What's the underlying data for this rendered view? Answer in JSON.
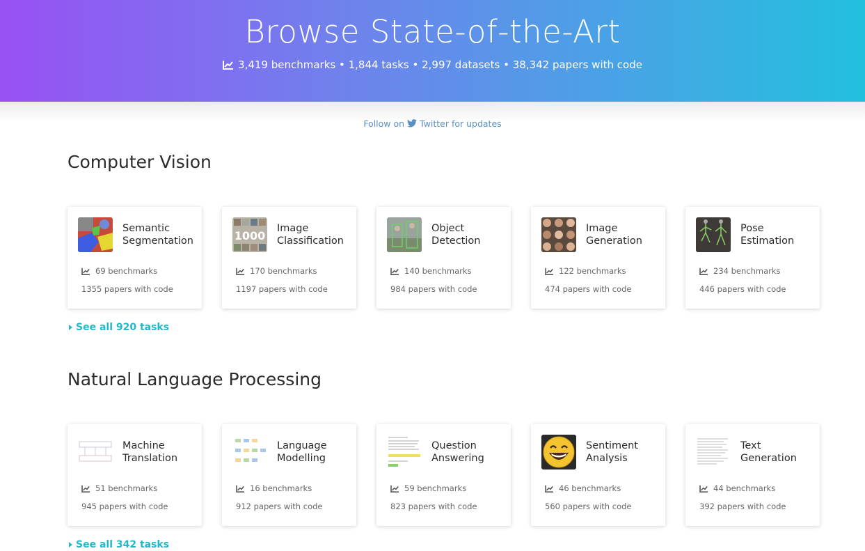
{
  "hero": {
    "title": "Browse State-of-the-Art",
    "stats": "3,419 benchmarks • 1,844 tasks • 2,997 datasets • 38,342 papers with code",
    "colors": {
      "gradient_start": "#9851f4",
      "gradient_end": "#22c0de"
    }
  },
  "follow": {
    "prefix": "Follow on",
    "suffix": "Twitter for updates"
  },
  "sections": [
    {
      "title": "Computer Vision",
      "see_all": "See all 920 tasks",
      "cards": [
        {
          "name": "Semantic Segmentation",
          "benchmarks": "69 benchmarks",
          "papers": "1355 papers with code"
        },
        {
          "name": "Image Classification",
          "benchmarks": "170 benchmarks",
          "papers": "1197 papers with code"
        },
        {
          "name": "Object Detection",
          "benchmarks": "140 benchmarks",
          "papers": "984 papers with code"
        },
        {
          "name": "Image Generation",
          "benchmarks": "122 benchmarks",
          "papers": "474 papers with code"
        },
        {
          "name": "Pose Estimation",
          "benchmarks": "234 benchmarks",
          "papers": "446 papers with code"
        }
      ]
    },
    {
      "title": "Natural Language Processing",
      "see_all": "See all 342 tasks",
      "cards": [
        {
          "name": "Machine Translation",
          "benchmarks": "51 benchmarks",
          "papers": "945 papers with code"
        },
        {
          "name": "Language Modelling",
          "benchmarks": "16 benchmarks",
          "papers": "912 papers with code"
        },
        {
          "name": "Question Answering",
          "benchmarks": "59 benchmarks",
          "papers": "823 papers with code"
        },
        {
          "name": "Sentiment Analysis",
          "benchmarks": "46 benchmarks",
          "papers": "560 papers with code"
        },
        {
          "name": "Text Generation",
          "benchmarks": "44 benchmarks",
          "papers": "392 papers with code"
        }
      ]
    }
  ]
}
